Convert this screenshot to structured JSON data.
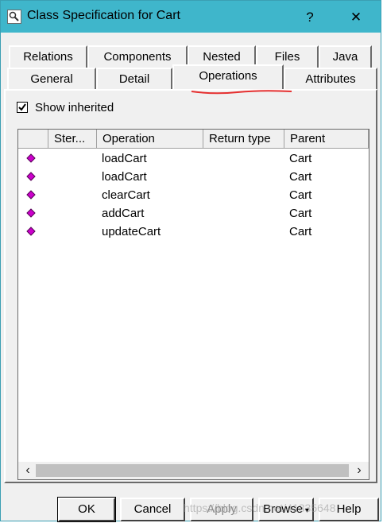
{
  "window": {
    "title": "Class Specification for Cart",
    "help_label": "?",
    "close_label": "✕"
  },
  "tabs_row1": [
    {
      "label": "Relations"
    },
    {
      "label": "Components"
    },
    {
      "label": "Nested"
    },
    {
      "label": "Files"
    },
    {
      "label": "Java"
    }
  ],
  "tabs_row2": [
    {
      "label": "General"
    },
    {
      "label": "Detail"
    },
    {
      "label": "Operations",
      "active": true
    },
    {
      "label": "Attributes"
    }
  ],
  "show_inherited": {
    "label": "Show inherited",
    "checked": true
  },
  "table": {
    "columns": [
      "",
      "Ster...",
      "Operation",
      "Return type",
      "Parent"
    ],
    "rows": [
      {
        "operation": "loadCart",
        "parent": "Cart"
      },
      {
        "operation": "loadCart",
        "parent": "Cart"
      },
      {
        "operation": "clearCart",
        "parent": "Cart"
      },
      {
        "operation": "addCart",
        "parent": "Cart"
      },
      {
        "operation": "updateCart",
        "parent": "Cart"
      }
    ],
    "row_icon": "operation-diamond-icon",
    "row_icon_color": "#cc00cc"
  },
  "buttons": {
    "ok": "OK",
    "cancel": "Cancel",
    "apply": "Apply",
    "browse": "Browse",
    "help": "Help"
  },
  "watermark": "https://blog.csdn.net/41335648",
  "colors": {
    "titlebar": "#3fb6cb",
    "annotation": "#e53030"
  }
}
